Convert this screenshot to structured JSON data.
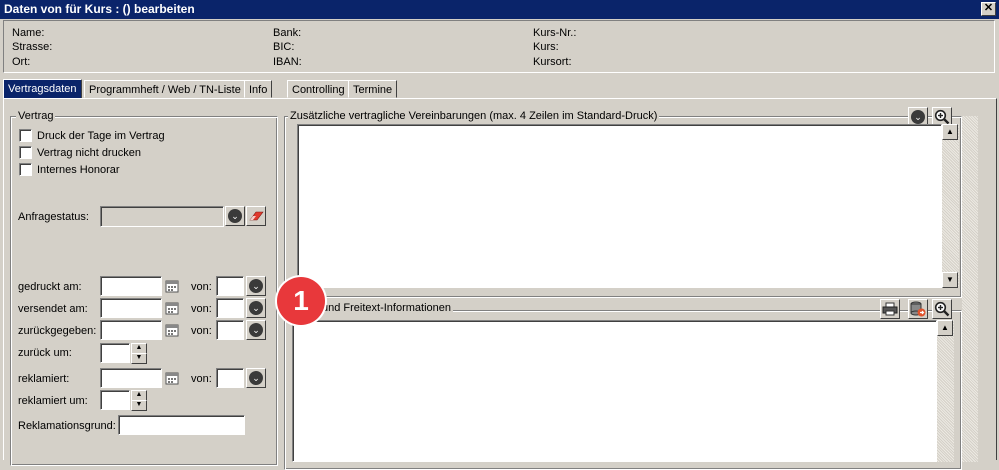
{
  "window": {
    "title": "Daten von  für Kurs : () bearbeiten",
    "close": "✕"
  },
  "info": {
    "col1": [
      "Name:",
      "Strasse:",
      "Ort:"
    ],
    "col2": [
      "Bank:",
      "BIC:",
      "IBAN:"
    ],
    "col3": [
      "Kurs-Nr.:",
      "Kurs:",
      "Kursort:"
    ]
  },
  "tabs": [
    "Vertragsdaten",
    "Programmheft / Web / TN-Liste",
    "Info",
    "Controlling",
    "Termine"
  ],
  "vertrag": {
    "title": "Vertrag",
    "checkboxes": [
      "Druck der Tage im Vertrag",
      "Vertrag nicht drucken",
      "Internes Honorar"
    ],
    "anfragestatus_label": "Anfragestatus:",
    "gedruckt_label": "gedruckt am:",
    "versendet_label": "versendet am:",
    "zurueckgegeben_label": "zurückgegeben:",
    "zurueck_um_label": "zurück um:",
    "reklamiert_label": "reklamiert:",
    "reklamiert_um_label": "reklamiert um:",
    "reklamationsgrund_label": "Reklamationsgrund:",
    "von_label": "von:"
  },
  "zusatz": {
    "title": "Zusätzliche vertragliche Vereinbarungen (max. 4 Zeilen im Standard-Druck)"
  },
  "freitext": {
    "title": "und Freitext-Informationen"
  },
  "badge": {
    "number": "1"
  }
}
